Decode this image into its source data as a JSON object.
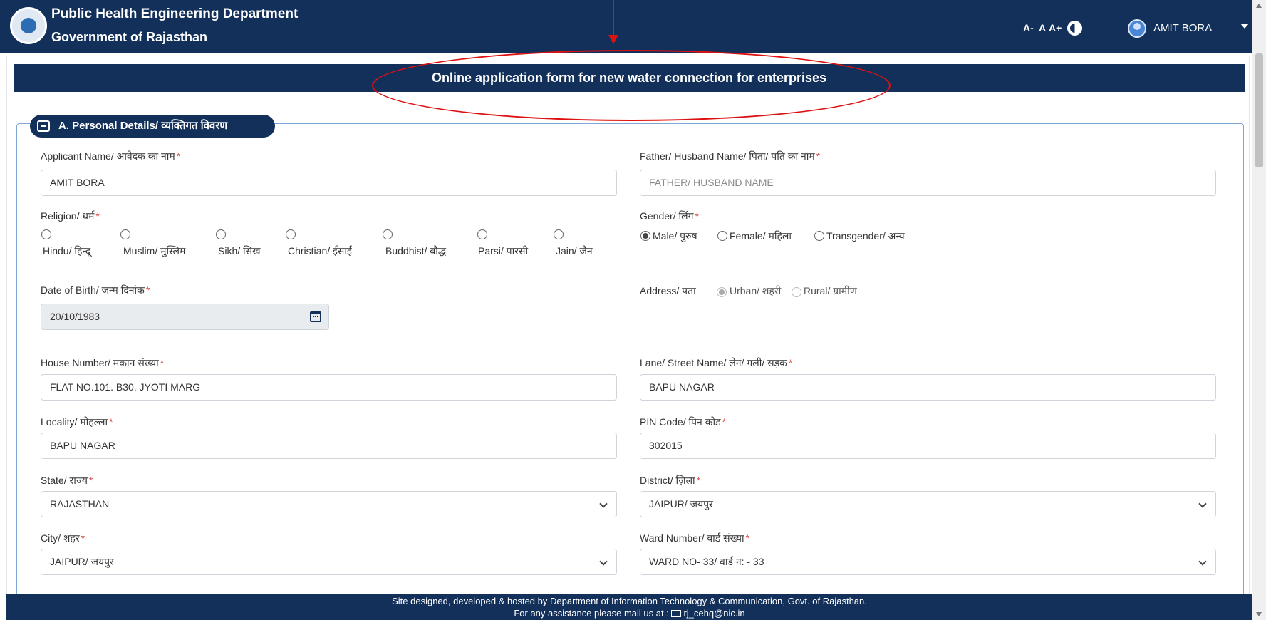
{
  "header": {
    "title": "Public Health Engineering Department",
    "subtitle": "Government of Rajasthan",
    "font_decrease": "A-",
    "font_reset": "A",
    "font_increase": "A+",
    "user_name": "AMIT BORA"
  },
  "banner": {
    "title": "Online application form for new water connection for enterprises"
  },
  "section": {
    "title": "A. Personal Details/ व्यक्तिगत विवरण"
  },
  "fields": {
    "applicant_name": {
      "label": "Applicant Name/ आवेदक का नाम",
      "value": "AMIT BORA"
    },
    "father_name": {
      "label": "Father/ Husband Name/ पिता/ पति का नाम",
      "placeholder": "FATHER/ HUSBAND NAME"
    },
    "religion": {
      "label": "Religion/ धर्म",
      "options": [
        "Hindu/ हिन्दू",
        "Muslim/ मुस्लिम",
        "Sikh/ सिख",
        "Christian/ ईसाई",
        "Buddhist/ बौद्ध",
        "Parsi/ पारसी",
        "Jain/ जैन"
      ],
      "selected": null
    },
    "gender": {
      "label": "Gender/ लिंग",
      "options": [
        "Male/ पुरुष",
        "Female/ महिला",
        "Transgender/ अन्य"
      ],
      "selected": "Male/ पुरुष"
    },
    "dob": {
      "label": "Date of Birth/ जन्म दिनांक",
      "value": "20/10/1983"
    },
    "address": {
      "label": "Address/ पता",
      "options": [
        "Urban/ शहरी",
        "Rural/ ग्रामीण"
      ],
      "selected": "Urban/ शहरी"
    },
    "house_number": {
      "label": "House Number/ मकान संख्या",
      "value": "FLAT NO.101. B30, JYOTI MARG"
    },
    "lane": {
      "label": "Lane/ Street Name/ लेन/ गली/ सड़क",
      "value": "BAPU NAGAR"
    },
    "locality": {
      "label": "Locality/ मोहल्ला",
      "value": "BAPU NAGAR"
    },
    "pin_code": {
      "label": "PIN Code/ पिन कोड",
      "value": "302015"
    },
    "state": {
      "label": "State/ राज्य",
      "value": "RAJASTHAN"
    },
    "district": {
      "label": "District/ ज़िला",
      "value": "JAIPUR/ जयपुर"
    },
    "city": {
      "label": "City/ शहर",
      "value": "JAIPUR/ जयपुर"
    },
    "ward": {
      "label": "Ward Number/ वार्ड संख्या",
      "value": "WARD NO- 33/ वार्ड न: - 33"
    }
  },
  "required_mark": "*",
  "footer": {
    "line1": "Site designed, developed & hosted by Department of Information Technology & Communication, Govt. of Rajasthan.",
    "line2_prefix": "For any assistance please mail us at : ",
    "email": "rj_cehq@nic.in"
  },
  "colors": {
    "primary": "#12305a",
    "annotation": "#dd1111",
    "required": "#d9534f"
  }
}
